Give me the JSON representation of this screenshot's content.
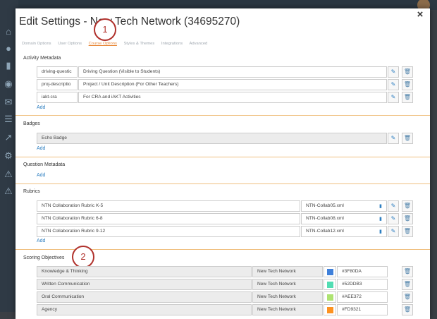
{
  "modal": {
    "title": "Edit Settings - New Tech Network (34695270)",
    "close": "×"
  },
  "tabs": [
    {
      "label": "Domain Options",
      "active": false
    },
    {
      "label": "User Options",
      "active": false
    },
    {
      "label": "Course Options",
      "active": true
    },
    {
      "label": "Styles & Themes",
      "active": false
    },
    {
      "label": "Integrations",
      "active": false
    },
    {
      "label": "Advanced",
      "active": false
    }
  ],
  "markers": [
    "1",
    "2"
  ],
  "activity_metadata": {
    "title": "Activity Metadata",
    "rows": [
      {
        "key": "driving-questic",
        "label": "Driving Question (Visible to Students)"
      },
      {
        "key": "proj-descriptio",
        "label": "Project / Unit Description (For Other Teachers)"
      },
      {
        "key": "iakt-cra",
        "label": "For CRA and iAKT Activities"
      }
    ],
    "add": "Add"
  },
  "badges": {
    "title": "Badges",
    "rows": [
      {
        "label": "Echo Badge"
      }
    ],
    "add": "Add"
  },
  "question_metadata": {
    "title": "Question Metadata",
    "add": "Add"
  },
  "rubrics": {
    "title": "Rubrics",
    "rows": [
      {
        "label": "NTN Collaboration Rubric K-5",
        "file": "NTN-Collab05.xml"
      },
      {
        "label": "NTN Collaboration Rubric 6-8",
        "file": "NTN-Collab08.xml"
      },
      {
        "label": "NTN Collaboration Rubric 9-12",
        "file": "NTN-Collab12.xml"
      }
    ],
    "add": "Add"
  },
  "scoring_objectives": {
    "title": "Scoring Objectives",
    "rows": [
      {
        "label": "Knowledge & Thinking",
        "org": "New Tech Network",
        "color": "#3F80DA"
      },
      {
        "label": "Written Communication",
        "org": "New Tech Network",
        "color": "#52DDB3"
      },
      {
        "label": "Oral Communication",
        "org": "New Tech Network",
        "color": "#AEE372"
      },
      {
        "label": "Agency",
        "org": "New Tech Network",
        "color": "#FD9321"
      }
    ]
  }
}
